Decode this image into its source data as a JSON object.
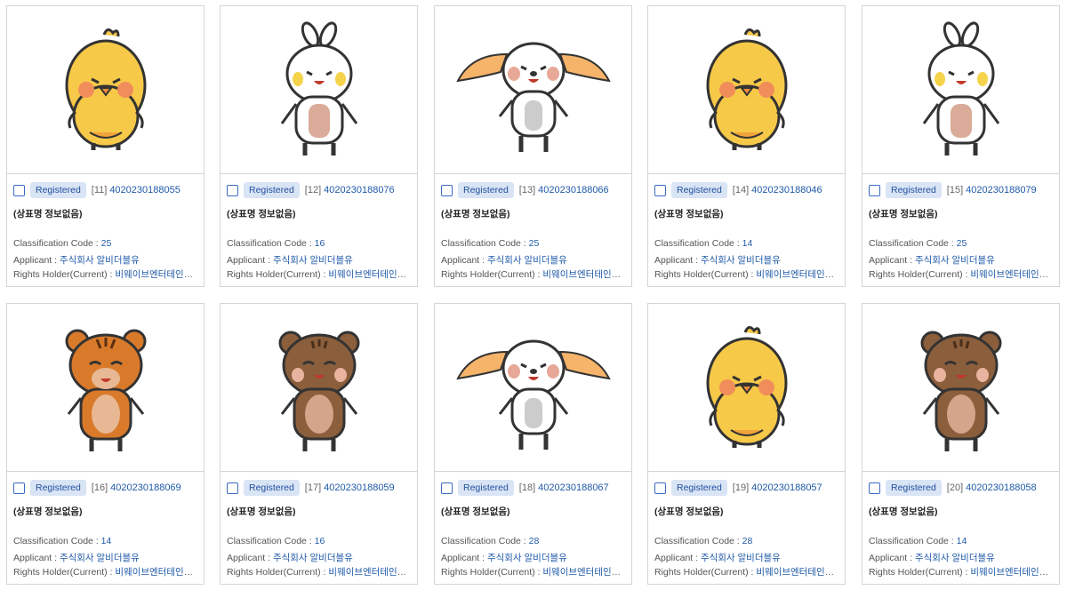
{
  "labels": {
    "classification": "Classification Code : ",
    "applicant": "Applicant : ",
    "holder": "Rights Holder(Current) : "
  },
  "cards": [
    {
      "character": "chick",
      "status": "Registered",
      "index": "[11]",
      "app_no": "4020230188055",
      "trademark": "(상표명 정보없음)",
      "class_code": "25",
      "applicant": "주식회사 알비더블유",
      "holder": "비웨이브엔터테인먼트..."
    },
    {
      "character": "bunny",
      "status": "Registered",
      "index": "[12]",
      "app_no": "4020230188076",
      "trademark": "(상표명 정보없음)",
      "class_code": "16",
      "applicant": "주식회사 알비더블유",
      "holder": "비웨이브엔터테인먼트..."
    },
    {
      "character": "puppy",
      "status": "Registered",
      "index": "[13]",
      "app_no": "4020230188066",
      "trademark": "(상표명 정보없음)",
      "class_code": "25",
      "applicant": "주식회사 알비더블유",
      "holder": "비웨이브엔터테인먼트..."
    },
    {
      "character": "chick",
      "status": "Registered",
      "index": "[14]",
      "app_no": "4020230188046",
      "trademark": "(상표명 정보없음)",
      "class_code": "14",
      "applicant": "주식회사 알비더블유",
      "holder": "비웨이브엔터테인먼트..."
    },
    {
      "character": "bunny",
      "status": "Registered",
      "index": "[15]",
      "app_no": "4020230188079",
      "trademark": "(상표명 정보없음)",
      "class_code": "25",
      "applicant": "주식회사 알비더블유",
      "holder": "비웨이브엔터테인먼트..."
    },
    {
      "character": "tiger",
      "status": "Registered",
      "index": "[16]",
      "app_no": "4020230188069",
      "trademark": "(상표명 정보없음)",
      "class_code": "14",
      "applicant": "주식회사 알비더블유",
      "holder": "비웨이브엔터테인먼트..."
    },
    {
      "character": "bear",
      "status": "Registered",
      "index": "[17]",
      "app_no": "4020230188059",
      "trademark": "(상표명 정보없음)",
      "class_code": "16",
      "applicant": "주식회사 알비더블유",
      "holder": "비웨이브엔터테인먼트..."
    },
    {
      "character": "puppy",
      "status": "Registered",
      "index": "[18]",
      "app_no": "4020230188067",
      "trademark": "(상표명 정보없음)",
      "class_code": "28",
      "applicant": "주식회사 알비더블유",
      "holder": "비웨이브엔터테인먼트..."
    },
    {
      "character": "chick",
      "status": "Registered",
      "index": "[19]",
      "app_no": "4020230188057",
      "trademark": "(상표명 정보없음)",
      "class_code": "28",
      "applicant": "주식회사 알비더블유",
      "holder": "비웨이브엔터테인먼트..."
    },
    {
      "character": "bear",
      "status": "Registered",
      "index": "[20]",
      "app_no": "4020230188058",
      "trademark": "(상표명 정보없음)",
      "class_code": "14",
      "applicant": "주식회사 알비더블유",
      "holder": "비웨이브엔터테인먼트..."
    }
  ]
}
